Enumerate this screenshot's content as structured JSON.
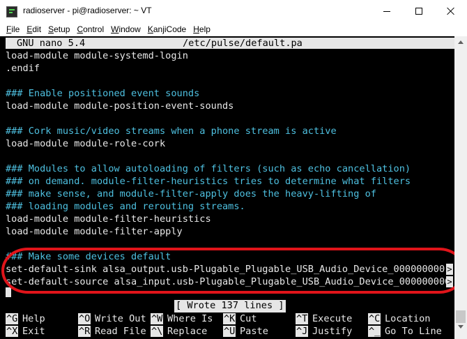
{
  "window": {
    "title": "radioserver - pi@radioserver: ~ VT",
    "icon": "teraterm-icon"
  },
  "menu": [
    {
      "key": "F",
      "rest": "ile"
    },
    {
      "key": "E",
      "rest": "dit"
    },
    {
      "key": "S",
      "rest": "etup"
    },
    {
      "key": "C",
      "rest": "ontrol"
    },
    {
      "key": "W",
      "rest": "indow"
    },
    {
      "key": "K",
      "rest": "anjiCode"
    },
    {
      "key": "H",
      "rest": "elp"
    }
  ],
  "nano": {
    "version": "GNU nano 5.4",
    "filename": "/etc/pulse/default.pa"
  },
  "lines": [
    "load-module module-systemd-login",
    ".endif",
    "",
    "### Enable positioned event sounds",
    "load-module module-position-event-sounds",
    "",
    "### Cork music/video streams when a phone stream is active",
    "load-module module-role-cork",
    "",
    "### Modules to allow autoloading of filters (such as echo cancellation)",
    "### on demand. module-filter-heuristics tries to determine what filters",
    "### make sense, and module-filter-apply does the heavy-lifting of",
    "### loading modules and rerouting streams.",
    "load-module module-filter-heuristics",
    "load-module module-filter-apply",
    "",
    "### Make some devices default",
    "set-default-sink alsa_output.usb-Plugable_Plugable_USB_Audio_Device_000000000",
    "set-default-source alsa_input.usb-Plugable_Plugable_USB_Audio_Device_000000000"
  ],
  "overflow_marker": ">",
  "status_message": "[ Wrote 137 lines ]",
  "shortcuts": [
    {
      "key": "^G",
      "label": "Help"
    },
    {
      "key": "^O",
      "label": "Write Out"
    },
    {
      "key": "^W",
      "label": "Where Is"
    },
    {
      "key": "^K",
      "label": "Cut"
    },
    {
      "key": "^T",
      "label": "Execute"
    },
    {
      "key": "^C",
      "label": "Location"
    },
    {
      "key": "^X",
      "label": "Exit"
    },
    {
      "key": "^R",
      "label": "Read File"
    },
    {
      "key": "^\\",
      "label": "Replace"
    },
    {
      "key": "^U",
      "label": "Paste"
    },
    {
      "key": "^J",
      "label": "Justify"
    },
    {
      "key": "^_",
      "label": "Go To Line"
    }
  ],
  "colors": {
    "terminal_bg": "#000000",
    "terminal_fg": "#e8e8e8",
    "comment": "#4ec0e0",
    "highlight": "#e0141a"
  }
}
